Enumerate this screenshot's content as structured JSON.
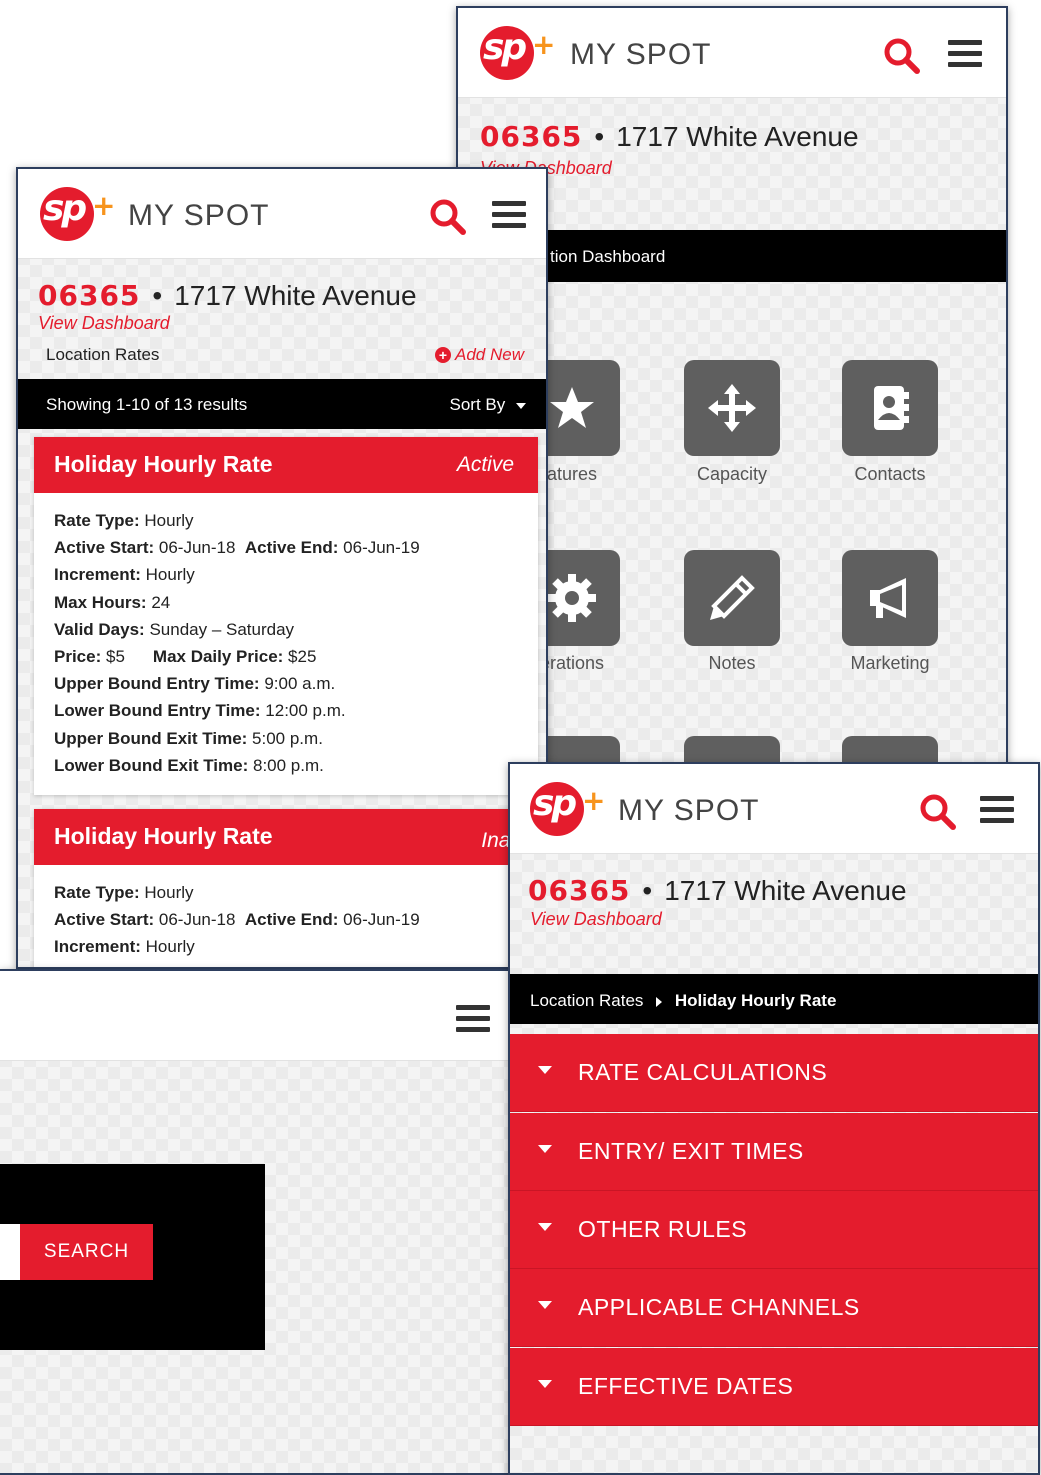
{
  "brand": {
    "name": "MY SPOT"
  },
  "location": {
    "code": "06365",
    "separator": "•",
    "address": "1717 White Avenue",
    "view_dashboard": "View Dashboard"
  },
  "dashboard": {
    "bar_title": "tion Dashboard",
    "tiles": [
      {
        "label": "atures",
        "icon": "star-icon"
      },
      {
        "label": "Capacity",
        "icon": "move-arrows-icon"
      },
      {
        "label": "Contacts",
        "icon": "address-book-icon"
      },
      {
        "label": "erations",
        "icon": "gear-icon"
      },
      {
        "label": "Notes",
        "icon": "pencil-icon"
      },
      {
        "label": "Marketing",
        "icon": "megaphone-icon"
      }
    ]
  },
  "rates_list": {
    "section_title": "Location Rates",
    "add_new": "Add New",
    "results_text": "Showing 1-10 of 13 results",
    "sort_label": "Sort By",
    "cards": [
      {
        "title": "Holiday Hourly Rate",
        "status": "Active",
        "rate_type_label": "Rate Type:",
        "rate_type": "Hourly",
        "active_start_label": "Active Start:",
        "active_start": "06-Jun-18",
        "active_end_label": "Active End:",
        "active_end": "06-Jun-19",
        "increment_label": "Increment:",
        "increment": "Hourly",
        "max_hours_label": "Max Hours:",
        "max_hours": "24",
        "valid_days_label": "Valid Days:",
        "valid_days": "Sunday – Saturday",
        "price_label": "Price:",
        "price": "$5",
        "max_daily_label": "Max Daily Price:",
        "max_daily": "$25",
        "upper_entry_label": "Upper Bound Entry Time:",
        "upper_entry": "9:00 a.m.",
        "lower_entry_label": "Lower Bound Entry Time:",
        "lower_entry": "12:00 p.m.",
        "upper_exit_label": "Upper Bound Exit Time:",
        "upper_exit": "5:00 p.m.",
        "lower_exit_label": "Lower Bound Exit Time:",
        "lower_exit": "8:00 p.m."
      },
      {
        "title": "Holiday Hourly Rate",
        "status": "Inactiv",
        "rate_type_label": "Rate Type:",
        "rate_type": "Hourly",
        "active_start_label": "Active Start:",
        "active_start": "06-Jun-18",
        "active_end_label": "Active End:",
        "active_end": "06-Jun-19",
        "increment_label": "Increment:",
        "increment": "Hourly"
      }
    ]
  },
  "search_screen": {
    "search_button": "SEARCH"
  },
  "rate_detail": {
    "breadcrumb_parent": "Location Rates",
    "breadcrumb_current": "Holiday Hourly Rate",
    "sections": [
      "RATE CALCULATIONS",
      "ENTRY/ EXIT TIMES",
      "OTHER RULES",
      "APPLICABLE CHANNELS",
      "EFFECTIVE DATES"
    ]
  },
  "colors": {
    "brand_red": "#e41c2d",
    "brand_orange": "#f7941d",
    "tile_gray": "#5f5f5f",
    "bar_black": "#000000"
  }
}
